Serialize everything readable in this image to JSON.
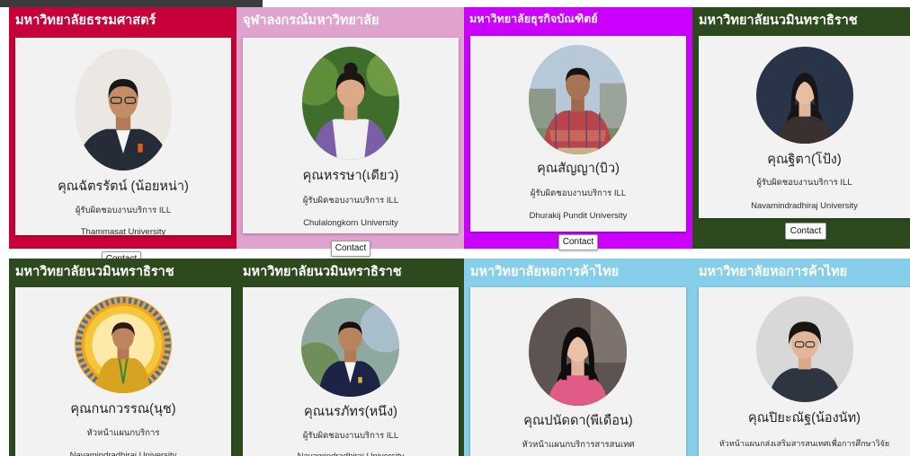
{
  "cards": [
    {
      "university_th": "มหาวิทยาลัยธรรมศาสตร์",
      "name": "คุณฉัตรรัตน์ (น้อยหน่า)",
      "role": "ผู้รับผิดชอบงานบริการ ILL",
      "university_en": "Thammasat University",
      "button": "Contact",
      "color": "#c8003a"
    },
    {
      "university_th": "จุฬาลงกรณ์มหาวิทยาลัย",
      "name": "คุณหรรษา(เดียว)",
      "role": "ผู้รับผิดชอบงานบริการ ILL",
      "university_en": "Chulalongkorn University",
      "button": "Contact",
      "color": "#dfa3cd"
    },
    {
      "university_th": "มหาวิทยาลัยธุรกิจบัณฑิตย์",
      "name": "คุณสัญญา(บิว)",
      "role": "ผู้รับผิดชอบงานบริการ ILL",
      "university_en": "Dhurakij Pundit University",
      "button": "Contact",
      "color": "#cc00ff"
    },
    {
      "university_th": "มหาวิทยาลัยนวมินทราธิราช",
      "name": "คุณฐิตา(โป้ง)",
      "role": "ผู้รับผิดชอบงานบริการ ILL",
      "university_en": "Navamindradhiraj University",
      "button": "Contact",
      "color": "#2c4a1e"
    },
    {
      "university_th": "มหาวิทยาลัยนวมินทราธิราช",
      "name": "คุณกนกวรรณ(นุช)",
      "role": "หัวหน้าแผนกบริการ",
      "university_en": "Navamindradhiraj University",
      "color": "#2c4a1e"
    },
    {
      "university_th": "มหาวิทยาลัยนวมินทราธิราช",
      "name": "คุณนรภัทร(หนึ่ง)",
      "role": "ผู้รับผิดชอบงานบริการ ILL",
      "university_en": "Navamindradhiraj University",
      "color": "#2c4a1e"
    },
    {
      "university_th": "มหาวิทยาลัยหอการค้าไทย",
      "name": "คุณปนัดดา(พี่เดือน)",
      "role": "หัวหน้าแผนกบริการสารสนเทศ",
      "color": "#87ceeb"
    },
    {
      "university_th": "มหาวิทยาลัยหอการค้าไทย",
      "name": "คุณปิยะณัฐ(น้องนัท)",
      "role": "หัวหน้าแผนกส่งเสริมสารสนเทศเพื่อการศึกษาวิจัย",
      "color": "#87ceeb"
    }
  ]
}
